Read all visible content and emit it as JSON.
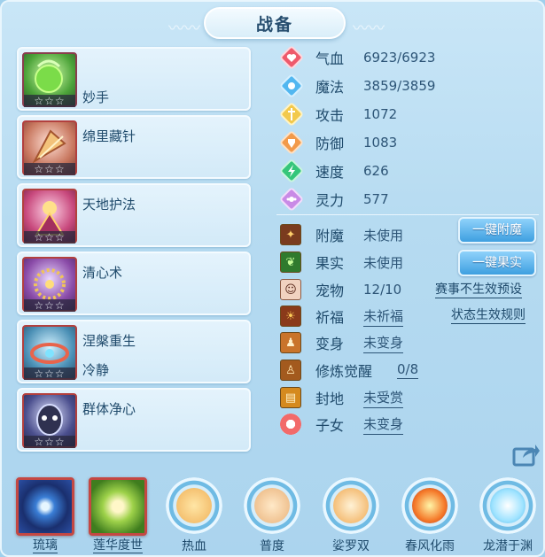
{
  "title": "战备",
  "skills": [
    {
      "name": "",
      "sub": "妙手",
      "stars": "☆☆☆"
    },
    {
      "name": "绵里藏针",
      "sub": "",
      "stars": "☆☆☆"
    },
    {
      "name": "天地护法",
      "sub": "",
      "stars": "☆☆☆"
    },
    {
      "name": "清心术",
      "sub": "",
      "stars": "☆☆☆"
    },
    {
      "name": "涅槃重生",
      "sub": "冷静",
      "stars": "☆☆☆"
    },
    {
      "name": "群体净心",
      "sub": "",
      "stars": "☆☆☆"
    }
  ],
  "stats": [
    {
      "label": "气血",
      "value": "6923/6923",
      "icon": "heart-icon",
      "color": "#ee5a6c"
    },
    {
      "label": "魔法",
      "value": "3859/3859",
      "icon": "mana-icon",
      "color": "#52b7f0"
    },
    {
      "label": "攻击",
      "value": "1072",
      "icon": "attack-icon",
      "color": "#f2c94c"
    },
    {
      "label": "防御",
      "value": "1083",
      "icon": "shield-icon",
      "color": "#f29a4a"
    },
    {
      "label": "速度",
      "value": "626",
      "icon": "speed-icon",
      "color": "#35c67a"
    },
    {
      "label": "灵力",
      "value": "577",
      "icon": "spirit-icon",
      "color": "#c98ae6"
    }
  ],
  "attrs": [
    {
      "label": "附魔",
      "value": "未使用",
      "underline": false
    },
    {
      "label": "果实",
      "value": "未使用",
      "underline": false
    },
    {
      "label": "宠物",
      "value": "12/10",
      "underline": false
    },
    {
      "label": "祈福",
      "value": "未祈福",
      "underline": true
    },
    {
      "label": "变身",
      "value": "未变身",
      "underline": true
    },
    {
      "label": "修炼觉醒",
      "value": "0/8",
      "underline": true
    },
    {
      "label": "封地",
      "value": "未受赏",
      "underline": true
    },
    {
      "label": "子女",
      "value": "未变身",
      "underline": true
    }
  ],
  "buttons": {
    "enchant": "一键附魔",
    "fruit": "一键果实"
  },
  "links": {
    "preset": "赛事不生效预设",
    "rules": "状态生效规则"
  },
  "bottom": [
    {
      "label": "琉璃",
      "type": "square"
    },
    {
      "label": "莲华度世",
      "type": "square"
    },
    {
      "label": "热血",
      "type": "ring"
    },
    {
      "label": "普度",
      "type": "ring"
    },
    {
      "label": "娑罗双",
      "type": "ring"
    },
    {
      "label": "春风化雨",
      "type": "ring"
    },
    {
      "label": "龙潜于渊",
      "type": "ring"
    }
  ]
}
